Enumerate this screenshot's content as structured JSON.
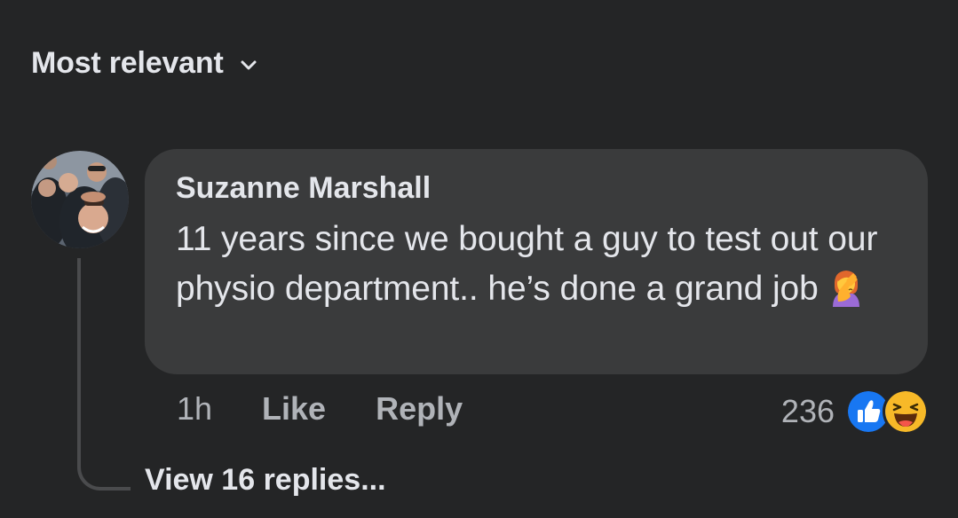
{
  "sort": {
    "label": "Most relevant",
    "icon": "chevron-down-icon"
  },
  "comment": {
    "author": "Suzanne Marshall",
    "text": "11 years since we bought a guy to test out our physio department.. he’s done a grand job",
    "text_emoji": "woman-facepalming-emoji",
    "time": "1h",
    "like_label": "Like",
    "reply_label": "Reply",
    "reaction_count": "236",
    "reactions": [
      "like-reaction-icon",
      "haha-reaction-icon"
    ],
    "view_replies_label": "View 16 replies..."
  },
  "colors": {
    "background": "#242526",
    "bubble": "#3a3b3c",
    "primary_text": "#e4e6eb",
    "secondary_text": "#b0b3b8",
    "like_blue": "#1877f2",
    "haha_yellow": "#f7b928"
  }
}
